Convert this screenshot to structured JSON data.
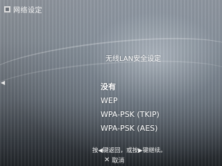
{
  "header": {
    "icon": "network-settings-icon",
    "title": "网络设定"
  },
  "dialog": {
    "title": "无线LAN安全设定",
    "options": [
      "没有",
      "WEP",
      "WPA-PSK (TKIP)",
      "WPA-PSK (AES)"
    ],
    "selected": "没有"
  },
  "footer": {
    "hint": "按◀键返回，或按▶键继续。",
    "back_icon": "cross-button-icon",
    "back_glyph": "✕",
    "back_label": "取消"
  },
  "nav": {
    "left_arrow": "◀"
  }
}
